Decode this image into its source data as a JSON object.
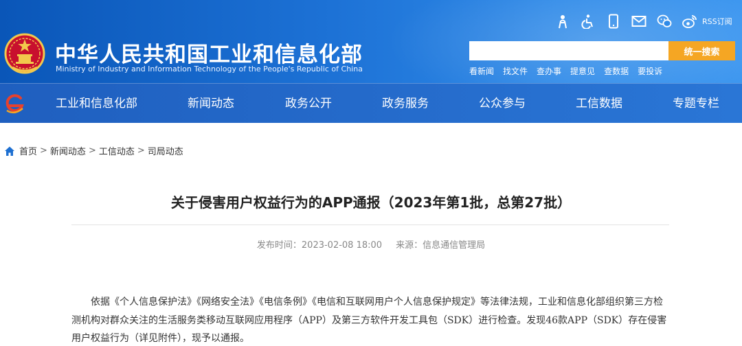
{
  "header": {
    "title_cn": "中华人民共和国工业和信息化部",
    "title_en": "Ministry of Industry and Information Technology of the People's Republic of China",
    "tool_icons": [
      "elder-care-icon",
      "accessibility-icon",
      "mobile-icon",
      "mail-icon",
      "wechat-icon",
      "weibo-icon"
    ],
    "rss_label": "RSS订阅",
    "search": {
      "placeholder": "",
      "button_label": "统一搜索"
    },
    "quick_links": [
      "看新闻",
      "找文件",
      "查办事",
      "提意见",
      "查数据",
      "要投诉"
    ]
  },
  "nav": {
    "items": [
      "工业和信息化部",
      "新闻动态",
      "政务公开",
      "政务服务",
      "公众参与",
      "工信数据",
      "专题专栏"
    ]
  },
  "breadcrumb": [
    "首页",
    "新闻动态",
    "工信动态",
    "司局动态"
  ],
  "article": {
    "title": "关于侵害用户权益行为的APP通报（2023年第1批，总第27批）",
    "publish_label": "发布时间：",
    "publish_time": "2023-02-08 18:00",
    "source_label": "来源：",
    "source": "信息通信管理局",
    "paragraph": "依据《个人信息保护法》《网络安全法》《电信条例》《电信和互联网用户个人信息保护规定》等法律法规，工业和信息化部组织第三方检测机构对群众关注的生活服务类移动互联网应用程序（APP）及第三方软件开发工具包（SDK）进行检查。发现46款APP（SDK）存在侵害用户权益行为（详见附件），现予以通报。"
  },
  "colors": {
    "header_blue": "#1d72d6",
    "nav_blue": "#2a76d6",
    "search_button": "#f5a623"
  }
}
